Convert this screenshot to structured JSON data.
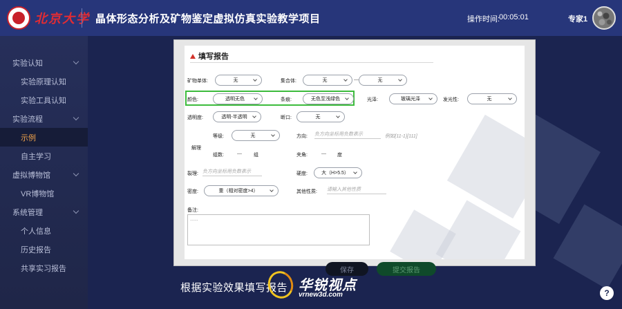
{
  "header": {
    "logo_text": "北京大学",
    "title": "晶体形态分析及矿物鉴定虚拟仿真实验教学项目",
    "timer_label": "操作时间:",
    "timer_value": "00:05:01",
    "user_name": "专家1"
  },
  "sidebar": {
    "items": [
      {
        "label": "实验认知",
        "type": "group"
      },
      {
        "label": "实验原理认知",
        "type": "sub"
      },
      {
        "label": "实验工具认知",
        "type": "sub"
      },
      {
        "label": "实验流程",
        "type": "group"
      },
      {
        "label": "示例",
        "type": "sub",
        "active": true
      },
      {
        "label": "自主学习",
        "type": "sub"
      },
      {
        "label": "虚拟博物馆",
        "type": "group"
      },
      {
        "label": "VR博物馆",
        "type": "sub"
      },
      {
        "label": "系统管理",
        "type": "group"
      },
      {
        "label": "个人信息",
        "type": "sub"
      },
      {
        "label": "历史报告",
        "type": "sub"
      },
      {
        "label": "共享实习报告",
        "type": "sub"
      }
    ]
  },
  "form": {
    "title": "填写报告",
    "mineral_single_label": "矿物单体:",
    "mineral_single_value": "无",
    "aggregate_label": "集合体:",
    "aggregate_value_1": "无",
    "aggregate_dash": "—",
    "aggregate_value_2": "无",
    "color_label": "颜色:",
    "color_value": "透明无色",
    "streak_label": "条痕:",
    "streak_value": "无色至浅绿色",
    "luster_label": "光泽:",
    "luster_value": "玻璃光泽",
    "fluorescence_label": "发光性:",
    "fluorescence_value": "无",
    "transparency_label": "透明度:",
    "transparency_value": "透明-半透明",
    "fracture_label": "断口:",
    "fracture_value": "无",
    "cleavage_label": "解理",
    "grade_label": "等级:",
    "grade_value": "无",
    "direction_label": "方向:",
    "direction_placeholder": "负方向坐标用负数表示",
    "direction_example": "例如{11-1}[111]",
    "groups_label": "组数:",
    "groups_dash": "—",
    "groups_unit": "组",
    "angle_label": "夹角:",
    "angle_dash": "—",
    "angle_unit": "度",
    "cleft_label": "裂理:",
    "cleft_placeholder": "负方向坐标用负数表示",
    "hardness_label": "硬度:",
    "hardness_value": "大（H>5.5）",
    "density_label": "密度:",
    "density_value": "重（相对密度>4）",
    "other_label": "其他性质:",
    "other_placeholder": "请输入其他性质",
    "remark_label": "备注:",
    "remark_placeholder": "......"
  },
  "buttons": {
    "save": "保存",
    "submit": "提交报告"
  },
  "caption": "根据实验效果填写报告",
  "watermark": {
    "brand": "华锐视点",
    "url": "vrnew3d.com"
  },
  "help_label": "?"
}
